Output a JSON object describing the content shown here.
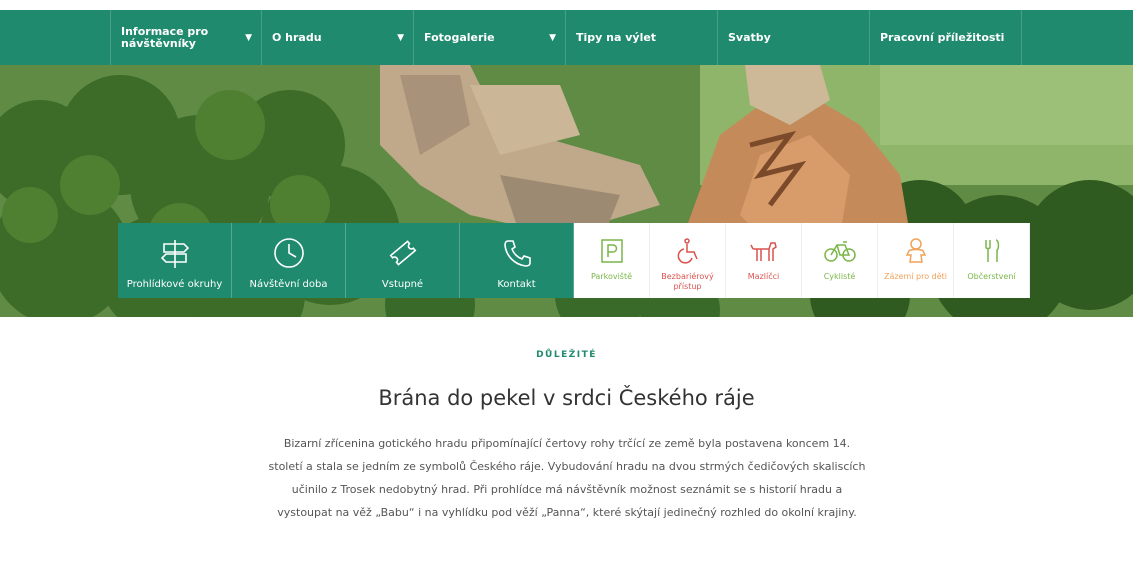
{
  "nav": {
    "items": [
      {
        "label": "Informace pro návštěvníky",
        "has_dropdown": true
      },
      {
        "label": "O hradu",
        "has_dropdown": true
      },
      {
        "label": "Fotogalerie",
        "has_dropdown": true
      },
      {
        "label": "Tipy na výlet",
        "has_dropdown": false
      },
      {
        "label": "Svatby",
        "has_dropdown": false
      },
      {
        "label": "Pracovní příležitosti",
        "has_dropdown": false
      }
    ],
    "dropdown_glyph": "▼"
  },
  "quick_links": [
    {
      "label": "Prohlídkové okruhy",
      "icon": "signpost-icon"
    },
    {
      "label": "Návštěvní doba",
      "icon": "clock-icon"
    },
    {
      "label": "Vstupné",
      "icon": "ticket-icon"
    },
    {
      "label": "Kontakt",
      "icon": "phone-icon"
    }
  ],
  "amenities": [
    {
      "label": "Parkoviště",
      "icon": "parking-icon",
      "color": "#7ab648"
    },
    {
      "label": "Bezbariérový přístup",
      "icon": "wheelchair-icon",
      "color": "#d9534f"
    },
    {
      "label": "Mazlíčci",
      "icon": "dog-icon",
      "color": "#d9534f"
    },
    {
      "label": "Cyklisté",
      "icon": "bicycle-icon",
      "color": "#7ab648"
    },
    {
      "label": "Zázemí pro děti",
      "icon": "baby-icon",
      "color": "#f0a25a"
    },
    {
      "label": "Občerstvení",
      "icon": "cutlery-icon",
      "color": "#7ab648"
    }
  ],
  "intro": {
    "eyebrow": "DŮLEŽITÉ",
    "title": "Brána do pekel v srdci Českého ráje",
    "text": "Bizarní zřícenina gotického hradu připomínající čertovy rohy trčící ze země byla postavena koncem 14. století a stala se jedním ze symbolů Českého ráje. Vybudování hradu na dvou strmých čedičových skaliscích učinilo z Trosek nedobytný hrad. Při prohlídce má návštěvník možnost seznámit se s historií hradu a vystoupat na věž „Babu“ i na vyhlídku pod věží „Panna“, které skýtají jedinečný rozhled do okolní krajiny."
  },
  "colors": {
    "brand_green": "#1f8a6e",
    "amenity_green": "#7ab648",
    "amenity_red": "#d9534f",
    "amenity_orange": "#f0a25a"
  }
}
